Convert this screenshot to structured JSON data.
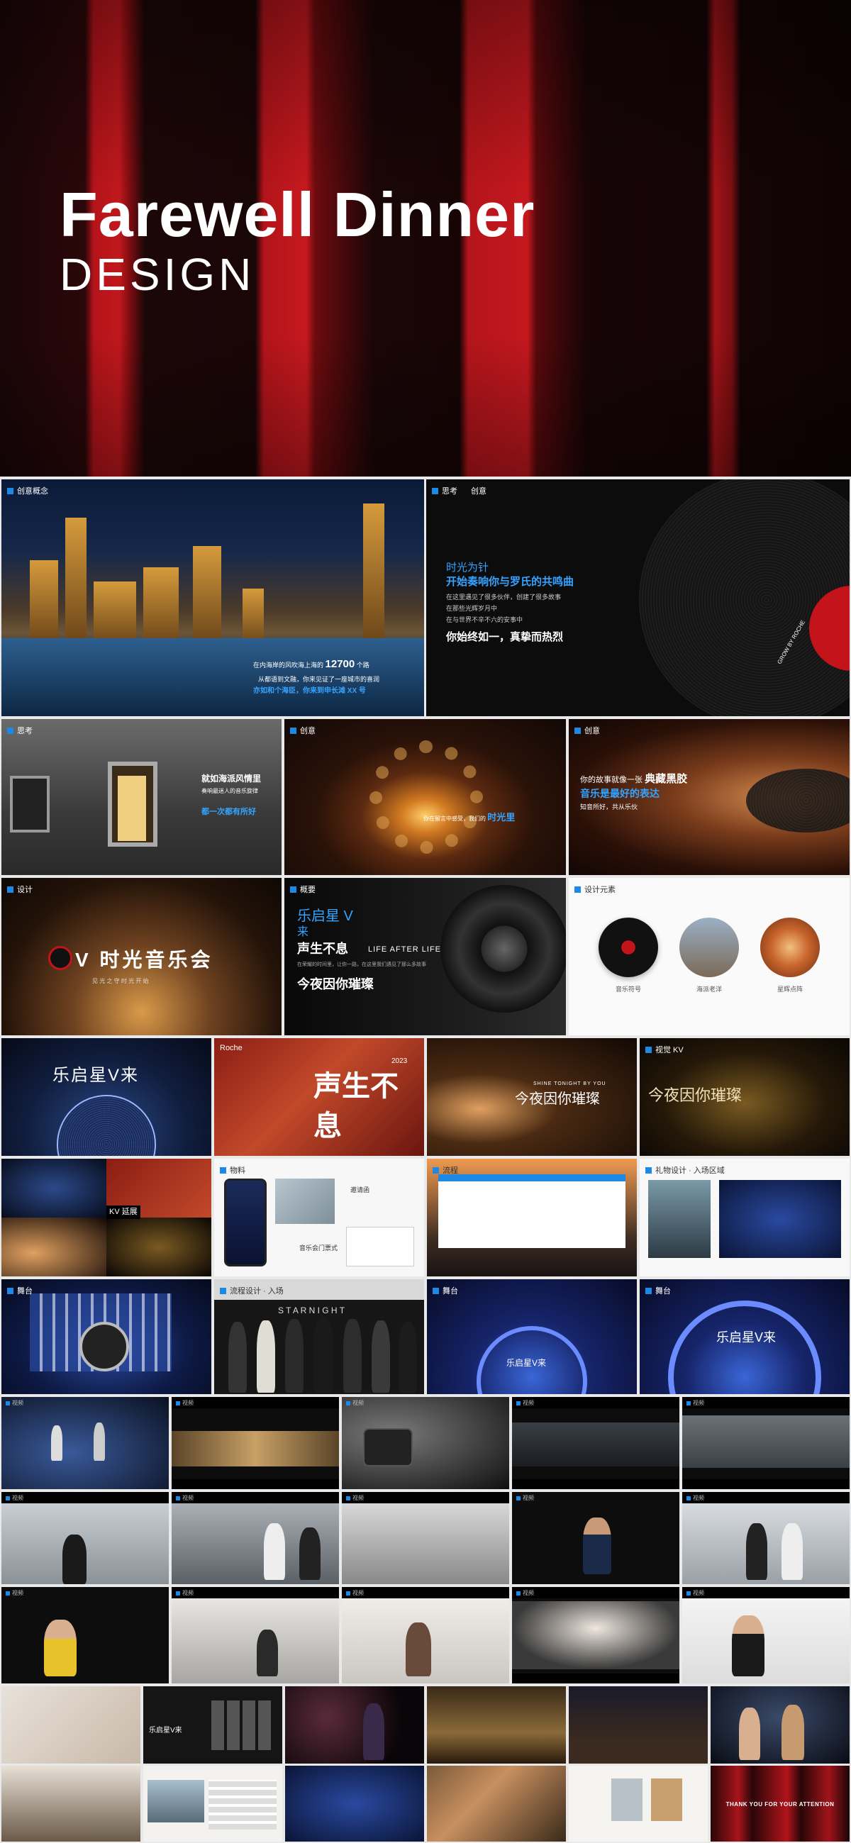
{
  "hero": {
    "title": "Farewell Dinner",
    "subtitle": "DESIGN"
  },
  "city_slide": {
    "tag": "创意概念",
    "line1_prefix": "在内海岸的风吹海上海的",
    "line1_number": "12700",
    "line1_suffix": "个路",
    "line2": "从都语到文融，你来见证了一座城市的喜润",
    "line3": "亦如和个海臣，你来到申长滩 XX 号"
  },
  "record_slide": {
    "tag1": "思考",
    "tag2": "创意",
    "heading1": "时光为针",
    "heading2": "开始奏响你与罗氏的共鸣曲",
    "body1": "在这里遇见了很多伙伴，创建了很多故事",
    "body2": "在那些光辉岁月中",
    "body3": "在与世界不辛不六的安事中",
    "closing": "你始终如一，真挚而热烈",
    "label_text": "GROW BY ROCHE"
  },
  "building_slide": {
    "tag": "思考",
    "line1": "就如海派风情里",
    "line2": "奏响最迷人的音乐旋律",
    "line3": "都一次都有所好"
  },
  "tunnel_slide": {
    "tag": "创意",
    "prefix": "你在留言中感受，我们的",
    "highlight": "时光里"
  },
  "turntable_slide": {
    "tag": "创意",
    "line1_prefix": "你的故事就像一张",
    "line1_highlight": "典藏黑胶",
    "line2": "音乐是最好的表达",
    "line3": "知音所好，共从乐伙"
  },
  "concert_slide": {
    "tag": "设计",
    "title": "V 时光音乐会",
    "subtitle": "见 光 之 守 时 光 开 始"
  },
  "speaker_slide": {
    "tag": "概要",
    "brand_line1": "乐启星 V",
    "brand_line2": "来",
    "slogan_cn": "声生不息",
    "slogan_en": "LIFE AFTER LIFE",
    "body": "在荣耀的时间里，让你一路，在这里我们遇见了那么多故事",
    "closing": "今夜因你璀璨"
  },
  "icons_slide": {
    "tag": "设计元素",
    "items": [
      {
        "label": "音乐符号"
      },
      {
        "label": "海派老洋"
      },
      {
        "label": "星辉点阵"
      }
    ]
  },
  "kv_row": {
    "k1_title": "乐启星V来",
    "k2_title": "声生不息",
    "k2_year": "2023",
    "k3_top": "SHINE TONIGHT BY YOU",
    "k3_title": "今夜因你璀璨",
    "k4_title": "今夜因你璀璨",
    "k2_tag": "Roche",
    "k4_tag": "视觉 KV"
  },
  "collateral_row": {
    "c1_tag": "KV 延展",
    "c1_caption": "KV 延展",
    "c2_tag": "物料",
    "c2_card1": "邀请函",
    "c2_card2": "音乐会门票式",
    "c3_tag": "流程",
    "c4_tag": "礼物设计 · 入场区域"
  },
  "stage_row": {
    "d1_tag": "舞台",
    "d2_tag": "流程设计 · 入场",
    "d2_title": "S T A R   N I G H T",
    "d3_tag": "舞台",
    "d3_title": "乐启星V来",
    "d4_tag": "舞台",
    "d4_title": "乐启星V来"
  },
  "video_tag": "视频",
  "bottom_row": {
    "thanks": "THANK YOU FOR YOUR ATTENTION",
    "small_brand": "乐启星V来"
  },
  "colors": {
    "accent_blue": "#1e88e5",
    "brand_red": "#c3141b"
  }
}
